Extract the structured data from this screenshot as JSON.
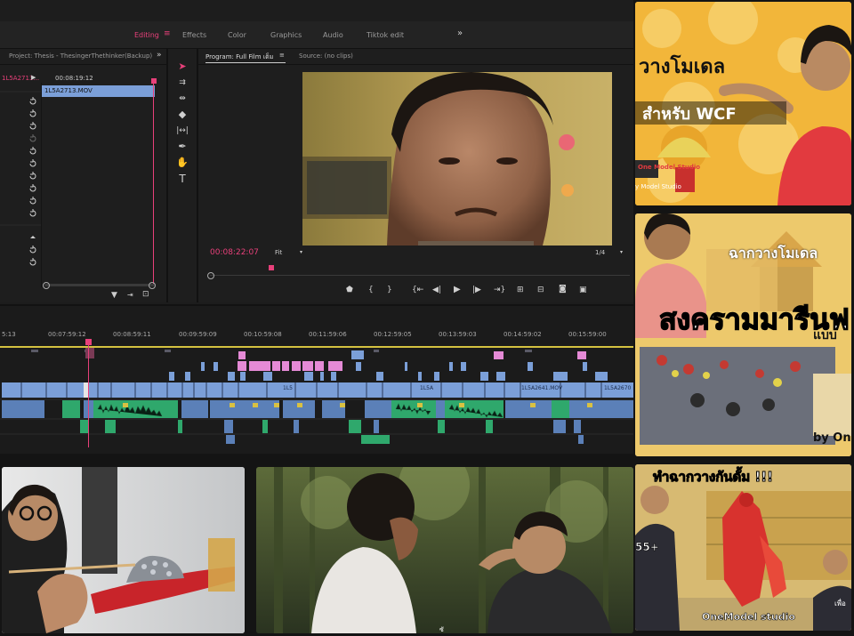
{
  "workspace": {
    "tabs": [
      "Editing",
      "Effects",
      "Color",
      "Graphics",
      "Audio",
      "Tiktok edit"
    ],
    "active": "Editing",
    "menu_icon": "hamburger-icon",
    "overflow_icon": "double-chevron-icon"
  },
  "project_panel": {
    "title": "Project: Thesis - ThesingerThethinker(Backup)",
    "left_clip": "1L5A2713...",
    "timecode": "00:08:19:12",
    "clip_name": "1L5A2713.MOV"
  },
  "program_monitor": {
    "title": "Program: Full Film เต็ม",
    "source_title": "Source: (no clips)",
    "timecode": "00:08:22:07",
    "zoom": "Fit",
    "resolution": "1/4"
  },
  "timeline": {
    "ruler": [
      "5:13",
      "00:07:59:12",
      "00:08:59:11",
      "00:09:59:09",
      "00:10:59:08",
      "00:11:59:06",
      "00:12:59:05",
      "00:13:59:03",
      "00:14:59:02",
      "00:15:59:00"
    ],
    "clip_labels": [
      "1L5",
      "1L5A",
      "1L5A2641.MOV",
      "1L5A2670"
    ]
  },
  "thumbnails": {
    "wcf": {
      "line1": "วางโมเดล",
      "line2": "สำหรับ WCF",
      "logo": "One Model Studio",
      "credit": "y Model Studio"
    },
    "marineford": {
      "line1": "ฉากวางโมเดล",
      "line2": "สงครามมารีนฟ",
      "line3": "แบบ",
      "credit": "by On"
    },
    "gundam": {
      "title": "ทำฉากวางกันดั้ม !!!",
      "badge": "55+",
      "credit": "OneModel studio",
      "side": "เพื่อ"
    },
    "subtitle_fragment": "ซั"
  },
  "colors": {
    "accent": "#e8407a",
    "video_clip": "#7b9fd8",
    "audio_clip": "#2fa86c",
    "graphic_clip": "#e58ad6",
    "thumb_yellow": "#f2b63a"
  }
}
